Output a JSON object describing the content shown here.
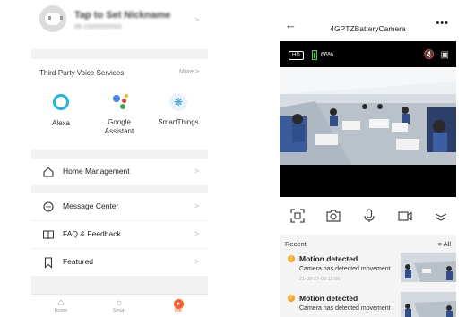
{
  "profile": {
    "nickname": "Tap to Set Nickname",
    "phone": "86-15000000000"
  },
  "voice": {
    "title": "Third-Party Voice Services",
    "more": "More",
    "services": [
      {
        "name": "Alexa",
        "icon": "alexa-icon"
      },
      {
        "name": "Google Assistant",
        "icon": "google-assistant-icon"
      },
      {
        "name": "SmartThings",
        "icon": "smartthings-icon"
      }
    ]
  },
  "menu": [
    {
      "label": "Home Management",
      "icon": "home-icon"
    },
    {
      "label": "Message Center",
      "icon": "message-icon"
    },
    {
      "label": "FAQ & Feedback",
      "icon": "book-icon"
    },
    {
      "label": "Featured",
      "icon": "bookmark-icon"
    }
  ],
  "tabs": [
    {
      "label": "Home",
      "icon": "home-icon"
    },
    {
      "label": "Smart",
      "icon": "sun-icon"
    },
    {
      "label": "Me",
      "icon": "user-icon",
      "active": true
    }
  ],
  "camera": {
    "title": "4GPTZBatteryCamera",
    "quality": "HD",
    "battery": "66%",
    "recent_label": "Recent",
    "all_label": "All",
    "events": [
      {
        "title": "Motion detected",
        "desc": "Camera has detected movement",
        "time": "21-02-27-09:12:06"
      },
      {
        "title": "Motion detected",
        "desc": "Camera has detected movement",
        "time": ""
      }
    ]
  },
  "colors": {
    "accent": "#ff5a28",
    "battery": "#3ad83a",
    "event_dot": "#f5a623",
    "alexa": "#1ab7e6"
  }
}
